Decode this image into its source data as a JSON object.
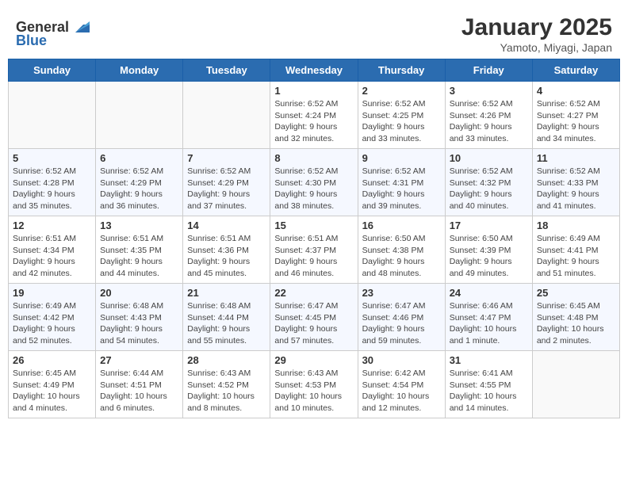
{
  "header": {
    "logo_general": "General",
    "logo_blue": "Blue",
    "month_title": "January 2025",
    "location": "Yamoto, Miyagi, Japan"
  },
  "weekdays": [
    "Sunday",
    "Monday",
    "Tuesday",
    "Wednesday",
    "Thursday",
    "Friday",
    "Saturday"
  ],
  "weeks": [
    {
      "days": [
        {
          "number": "",
          "empty": true
        },
        {
          "number": "",
          "empty": true
        },
        {
          "number": "",
          "empty": true
        },
        {
          "number": "1",
          "sunrise": "6:52 AM",
          "sunset": "4:24 PM",
          "daylight": "9 hours and 32 minutes."
        },
        {
          "number": "2",
          "sunrise": "6:52 AM",
          "sunset": "4:25 PM",
          "daylight": "9 hours and 33 minutes."
        },
        {
          "number": "3",
          "sunrise": "6:52 AM",
          "sunset": "4:26 PM",
          "daylight": "9 hours and 33 minutes."
        },
        {
          "number": "4",
          "sunrise": "6:52 AM",
          "sunset": "4:27 PM",
          "daylight": "9 hours and 34 minutes."
        }
      ]
    },
    {
      "days": [
        {
          "number": "5",
          "sunrise": "6:52 AM",
          "sunset": "4:28 PM",
          "daylight": "9 hours and 35 minutes."
        },
        {
          "number": "6",
          "sunrise": "6:52 AM",
          "sunset": "4:29 PM",
          "daylight": "9 hours and 36 minutes."
        },
        {
          "number": "7",
          "sunrise": "6:52 AM",
          "sunset": "4:29 PM",
          "daylight": "9 hours and 37 minutes."
        },
        {
          "number": "8",
          "sunrise": "6:52 AM",
          "sunset": "4:30 PM",
          "daylight": "9 hours and 38 minutes."
        },
        {
          "number": "9",
          "sunrise": "6:52 AM",
          "sunset": "4:31 PM",
          "daylight": "9 hours and 39 minutes."
        },
        {
          "number": "10",
          "sunrise": "6:52 AM",
          "sunset": "4:32 PM",
          "daylight": "9 hours and 40 minutes."
        },
        {
          "number": "11",
          "sunrise": "6:52 AM",
          "sunset": "4:33 PM",
          "daylight": "9 hours and 41 minutes."
        }
      ]
    },
    {
      "days": [
        {
          "number": "12",
          "sunrise": "6:51 AM",
          "sunset": "4:34 PM",
          "daylight": "9 hours and 42 minutes."
        },
        {
          "number": "13",
          "sunrise": "6:51 AM",
          "sunset": "4:35 PM",
          "daylight": "9 hours and 44 minutes."
        },
        {
          "number": "14",
          "sunrise": "6:51 AM",
          "sunset": "4:36 PM",
          "daylight": "9 hours and 45 minutes."
        },
        {
          "number": "15",
          "sunrise": "6:51 AM",
          "sunset": "4:37 PM",
          "daylight": "9 hours and 46 minutes."
        },
        {
          "number": "16",
          "sunrise": "6:50 AM",
          "sunset": "4:38 PM",
          "daylight": "9 hours and 48 minutes."
        },
        {
          "number": "17",
          "sunrise": "6:50 AM",
          "sunset": "4:39 PM",
          "daylight": "9 hours and 49 minutes."
        },
        {
          "number": "18",
          "sunrise": "6:49 AM",
          "sunset": "4:41 PM",
          "daylight": "9 hours and 51 minutes."
        }
      ]
    },
    {
      "days": [
        {
          "number": "19",
          "sunrise": "6:49 AM",
          "sunset": "4:42 PM",
          "daylight": "9 hours and 52 minutes."
        },
        {
          "number": "20",
          "sunrise": "6:48 AM",
          "sunset": "4:43 PM",
          "daylight": "9 hours and 54 minutes."
        },
        {
          "number": "21",
          "sunrise": "6:48 AM",
          "sunset": "4:44 PM",
          "daylight": "9 hours and 55 minutes."
        },
        {
          "number": "22",
          "sunrise": "6:47 AM",
          "sunset": "4:45 PM",
          "daylight": "9 hours and 57 minutes."
        },
        {
          "number": "23",
          "sunrise": "6:47 AM",
          "sunset": "4:46 PM",
          "daylight": "9 hours and 59 minutes."
        },
        {
          "number": "24",
          "sunrise": "6:46 AM",
          "sunset": "4:47 PM",
          "daylight": "10 hours and 1 minute."
        },
        {
          "number": "25",
          "sunrise": "6:45 AM",
          "sunset": "4:48 PM",
          "daylight": "10 hours and 2 minutes."
        }
      ]
    },
    {
      "days": [
        {
          "number": "26",
          "sunrise": "6:45 AM",
          "sunset": "4:49 PM",
          "daylight": "10 hours and 4 minutes."
        },
        {
          "number": "27",
          "sunrise": "6:44 AM",
          "sunset": "4:51 PM",
          "daylight": "10 hours and 6 minutes."
        },
        {
          "number": "28",
          "sunrise": "6:43 AM",
          "sunset": "4:52 PM",
          "daylight": "10 hours and 8 minutes."
        },
        {
          "number": "29",
          "sunrise": "6:43 AM",
          "sunset": "4:53 PM",
          "daylight": "10 hours and 10 minutes."
        },
        {
          "number": "30",
          "sunrise": "6:42 AM",
          "sunset": "4:54 PM",
          "daylight": "10 hours and 12 minutes."
        },
        {
          "number": "31",
          "sunrise": "6:41 AM",
          "sunset": "4:55 PM",
          "daylight": "10 hours and 14 minutes."
        },
        {
          "number": "",
          "empty": true
        }
      ]
    }
  ]
}
